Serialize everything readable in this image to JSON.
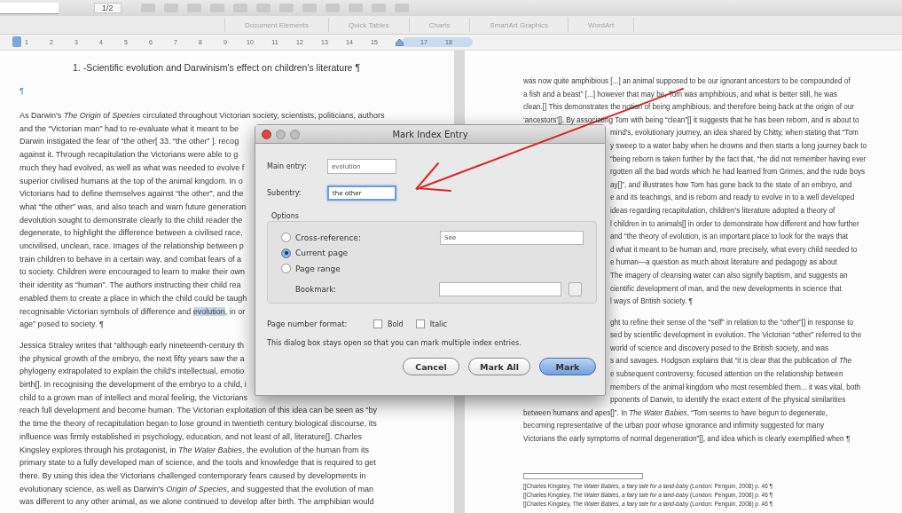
{
  "toolbar": {
    "page_field": "1/2"
  },
  "ribbon": {
    "tabs": [
      {
        "label": "Document Elements",
        "selected": false
      },
      {
        "label": "Quick Tables",
        "selected": false
      },
      {
        "label": "Charts",
        "selected": false
      },
      {
        "label": "SmartArt Graphics",
        "selected": false
      },
      {
        "label": "WordArt",
        "selected": false
      }
    ]
  },
  "ruler": {
    "marks": [
      {
        "kind": "number",
        "label": "1"
      },
      {
        "kind": "number",
        "label": "2"
      },
      {
        "kind": "number",
        "label": "3"
      },
      {
        "kind": "number",
        "label": "4"
      },
      {
        "kind": "number",
        "label": "5"
      },
      {
        "kind": "number",
        "label": "6"
      },
      {
        "kind": "number",
        "label": "7"
      },
      {
        "kind": "number",
        "label": "8"
      },
      {
        "kind": "number",
        "label": "9"
      },
      {
        "kind": "number",
        "label": "10"
      },
      {
        "kind": "number",
        "label": "11"
      },
      {
        "kind": "number",
        "label": "12"
      },
      {
        "kind": "number",
        "label": "13"
      },
      {
        "kind": "number",
        "label": "14"
      },
      {
        "kind": "number",
        "label": "15"
      },
      {
        "kind": "indent_marker"
      },
      {
        "kind": "number",
        "label": "17"
      },
      {
        "kind": "number",
        "label": "18"
      }
    ]
  },
  "left_page": {
    "heading": "1. -Scientific evolution and Darwinism's effect on children's literature ¶",
    "empty_paragraph": "¶",
    "paragraphs": [
      {
        "lines": [
          {
            "text": "As Darwin's *The Origin of Species* circulated throughout Victorian society, scientists, politicians, authors"
          },
          {
            "text": "and the “Victorian man” had to re-evaluate what it meant to be"
          },
          {
            "text": "Darwin instigated the fear of “the other[ 33. “the other” ]. recog"
          },
          {
            "text": "against it. Through recapitulation the Victorians were able to g"
          },
          {
            "text": "much they had evolved, as well as what was needed to evolve f"
          },
          {
            "text": "superior civilised humans at the top of the animal kingdom. In o"
          },
          {
            "text": "Victorians had to define themselves against “the other”, and the"
          },
          {
            "text": "what “the other” was, and also teach and warn future generation"
          },
          {
            "text": "devolution sought to demonstrate clearly to the child reader the"
          },
          {
            "text": "degenerate, to highlight the difference between a civilised race,"
          },
          {
            "text": "uncivilised, unclean, race. Images of the relationship between p"
          },
          {
            "text": "train children to behave in a certain way, and combat fears of a"
          },
          {
            "text": "to society. Children were encouraged to learn to make their own"
          },
          {
            "text": "their identity as “human”. The authors instructing their child rea"
          },
          {
            "text": "enabled them to create a place in which the child could be taugh"
          },
          {
            "text": "recognisable Victorian symbols of difference and ",
            "highlight": "evolution",
            "after": ", in or"
          },
          {
            "text": "age” posed to society. ¶"
          }
        ]
      },
      {
        "lines": [
          {
            "text": "Jessica Straley writes that “although early nineteenth-century th"
          },
          {
            "text": "the physical growth of the embryo, the next fifty years saw the a"
          },
          {
            "text": "phylogeny extrapolated to explain the child's intellectual, emotio"
          },
          {
            "text": "birth[]. In recognising the development of the embryo to a child, i"
          },
          {
            "text": "child to a grown man of intellect and moral feeling, the Victorians"
          },
          {
            "text": "reach full development and become human. The Victorian exploitation of this idea can be seen as “by"
          },
          {
            "text": "the time the theory of recapitulation began to lose ground in twentieth century biological discourse, its"
          },
          {
            "text": "influence was firmly established in psychology, education, and not least of all, literature[]. Charles"
          },
          {
            "text": "Kingsley explores through his protagonist, in *The Water Babies*, the evolution of the human from its"
          },
          {
            "text": "primary state to a fully developed man of science, and the tools and knowledge that is required to get"
          },
          {
            "text": "there. By using this idea the Victorians challenged contemporary fears caused by developments in"
          },
          {
            "text": "evolutionary science, as well as Darwin's *Origin of Species*, and suggested that the evolution of man"
          },
          {
            "text": "was different to any other animal, as we alone continued to develop after birth. The amphibian would"
          }
        ]
      }
    ]
  },
  "right_page": {
    "paragraphs": [
      {
        "lines": [
          {
            "kind": "full",
            "text": "was now quite amphibious [...] an animal supposed to be our ignorant ancestors to be compounded of"
          },
          {
            "kind": "full",
            "text": "a fish and a beast” [...] however that may be, Tom was amphibious, and what is better still, he was"
          },
          {
            "kind": "full",
            "text": "clean.[] This demonstrates the notion of being amphibious, and therefore being back at the origin of our"
          },
          {
            "kind": "full",
            "text": "‘ancestors’[]. By associating Tom with being “clean”[] it suggests that he has been reborn, and is about to"
          },
          {
            "kind": "beside_dialog",
            "text": "mind's, evolutionary journey, an idea shared by Chitty, when stating that “Tom"
          },
          {
            "kind": "beside_dialog",
            "text": "y sweep to a water baby when he drowns and then starts a long journey back to"
          },
          {
            "kind": "beside_dialog",
            "text": "“being reborn is taken further by the fact that, “he did not remember having ever"
          },
          {
            "kind": "beside_dialog",
            "text": "rgotten all the bad words which he had learned from Grimes, and the rude boys"
          },
          {
            "kind": "beside_dialog",
            "text": "ay[]”, and illustrates how Tom has gone back to the state of an embryo, and"
          },
          {
            "kind": "beside_dialog",
            "text": "e and its teachings, and is reborn and ready to evolve in to a well developed"
          },
          {
            "kind": "beside_dialog",
            "text": "ideas regarding recapitulation, children's literature adopted a theory of"
          },
          {
            "kind": "beside_dialog",
            "text": "l children in to animals[] in order to demonstrate how different and how further"
          },
          {
            "kind": "beside_dialog",
            "text": "and “the theory of evolution, is an important place to look for the ways that"
          },
          {
            "kind": "beside_dialog",
            "text": "d what it meant to be human and, more precisely, what every child needed to"
          },
          {
            "kind": "beside_dialog",
            "text": "e human—a question as much about literature and pedagogy as about"
          },
          {
            "kind": "beside_dialog",
            "text": "The imagery of cleansing water can also signify baptism, and suggests an"
          },
          {
            "kind": "beside_dialog",
            "text": "cientific development of man, and the new developments in science that"
          },
          {
            "kind": "beside_dialog",
            "text": "l ways of British society. ¶"
          }
        ]
      },
      {
        "lines": [
          {
            "kind": "beside_dialog",
            "text": "ght to refine their sense of the “self” in relation to the “other”[] in response to"
          },
          {
            "kind": "beside_dialog",
            "text": "sed by scientific development in evolution. The Victorian “other” referred to the"
          },
          {
            "kind": "beside_dialog",
            "text": "world of science and discovery posed to the British society, and was"
          },
          {
            "kind": "beside_dialog",
            "text": "s and savages. Hodgson explains that “it is clear that the publication of *The*"
          },
          {
            "kind": "beside_dialog",
            "text": "e subsequent controversy, focused attention on the relationship between"
          },
          {
            "kind": "beside_dialog",
            "text": "members of the animal kingdom who most resembled them... it was vital, both"
          },
          {
            "kind": "beside_dialog",
            "text": "pponents of Darwin, to identify the exact extent of the physical similarities"
          },
          {
            "kind": "full",
            "text": "between humans and apes[]”. In *The Water Babies*, “Tom seems to have begun to degenerate,"
          },
          {
            "kind": "full",
            "text": "becoming representative of the urban poor whose ignorance and infirmity suggested for many"
          },
          {
            "kind": "full",
            "text": "Victorians the early symptoms of normal degeneration”[], and idea which is clearly exemplified when ¶"
          }
        ]
      }
    ],
    "footnotes": [
      "[]Charles Kingsley, *The Water Babies, a fairy tale for a land-baby* (London: Penguin, 2008) p. 46 ¶",
      "[]Charles Kingsley, *The Water Babies, a fairy tale for a land-baby* (London: Penguin, 2008) p. 46 ¶",
      "[]Charles Kingsley, *The Water Babies, a fairy tale for a land-baby* (London: Penguin, 2008) p. 46 ¶"
    ]
  },
  "dialog": {
    "title": "Mark Index Entry",
    "main_entry": {
      "label": "Main entry:",
      "value": "evolution",
      "focused": false
    },
    "subentry": {
      "label": "Subentry:",
      "value": "the other",
      "focused": true
    },
    "options": {
      "title": "Options",
      "choices": [
        {
          "label": "Cross-reference:",
          "selected": false,
          "field_value": "See"
        },
        {
          "label": "Current page",
          "selected": true
        },
        {
          "label": "Page range",
          "selected": false
        }
      ],
      "bookmark_label": "Bookmark:"
    },
    "page_number_format": {
      "label": "Page number format:",
      "checkboxes": [
        {
          "label": "Bold",
          "checked": false
        },
        {
          "label": "Italic",
          "checked": false
        }
      ]
    },
    "note": "This dialog box stays open so that you can mark multiple index entries.",
    "buttons": [
      {
        "label": "Cancel",
        "default": false
      },
      {
        "label": "Mark All",
        "default": false
      },
      {
        "label": "Mark",
        "default": true
      }
    ]
  }
}
